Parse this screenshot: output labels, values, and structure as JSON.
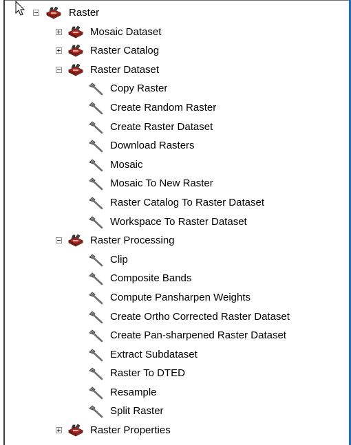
{
  "tree": {
    "root": {
      "label": "Raster",
      "icon": "toolbox-icon",
      "expanded": true
    },
    "toolsets": [
      {
        "label": "Mosaic Dataset",
        "icon": "toolbox-icon",
        "expanded": false,
        "tools": []
      },
      {
        "label": "Raster Catalog",
        "icon": "toolbox-icon",
        "expanded": false,
        "tools": []
      },
      {
        "label": "Raster Dataset",
        "icon": "toolbox-icon",
        "expanded": true,
        "tools": [
          {
            "label": "Copy Raster",
            "icon": "hammer-icon"
          },
          {
            "label": "Create Random Raster",
            "icon": "hammer-icon"
          },
          {
            "label": "Create Raster Dataset",
            "icon": "hammer-icon"
          },
          {
            "label": "Download Rasters",
            "icon": "hammer-icon"
          },
          {
            "label": "Mosaic",
            "icon": "hammer-icon"
          },
          {
            "label": "Mosaic To New Raster",
            "icon": "hammer-icon"
          },
          {
            "label": "Raster Catalog To Raster Dataset",
            "icon": "hammer-icon"
          },
          {
            "label": "Workspace To Raster Dataset",
            "icon": "hammer-icon"
          }
        ]
      },
      {
        "label": "Raster Processing",
        "icon": "toolbox-icon",
        "expanded": true,
        "tools": [
          {
            "label": "Clip",
            "icon": "hammer-icon"
          },
          {
            "label": "Composite Bands",
            "icon": "hammer-icon"
          },
          {
            "label": "Compute Pansharpen Weights",
            "icon": "hammer-icon"
          },
          {
            "label": "Create Ortho Corrected Raster Dataset",
            "icon": "hammer-icon"
          },
          {
            "label": "Create Pan-sharpened Raster Dataset",
            "icon": "hammer-icon"
          },
          {
            "label": "Extract Subdataset",
            "icon": "hammer-icon"
          },
          {
            "label": "Raster To DTED",
            "icon": "hammer-icon"
          },
          {
            "label": "Resample",
            "icon": "hammer-icon"
          },
          {
            "label": "Split Raster",
            "icon": "hammer-icon"
          }
        ]
      },
      {
        "label": "Raster Properties",
        "icon": "toolbox-icon",
        "expanded": false,
        "tools": []
      }
    ]
  },
  "colors": {
    "background": "#ffffff",
    "text": "#000000",
    "expander_border": "#919191",
    "toolbox_red": "#b3261e",
    "toolbox_dark": "#5a1f1a",
    "hammer_gray": "#6e6e6e",
    "frame_right": "#1f6fb8"
  }
}
